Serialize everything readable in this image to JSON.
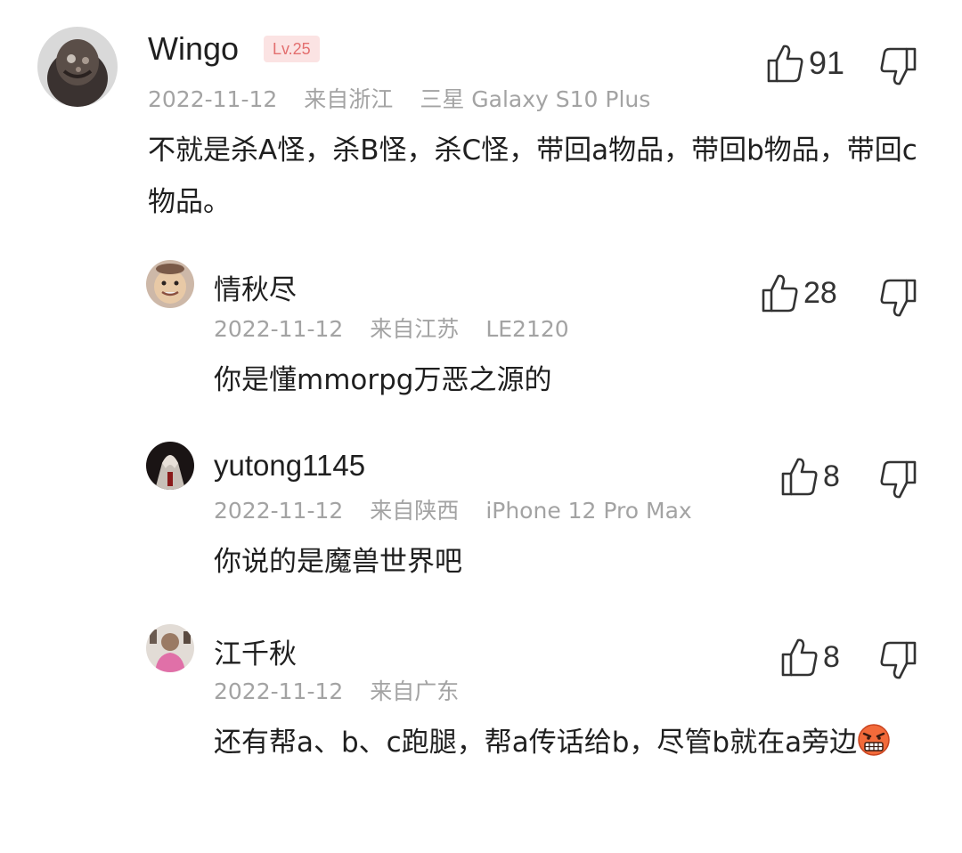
{
  "comments": [
    {
      "user": "Wingo",
      "level": "Lv.25",
      "date": "2022-11-12",
      "location": "来自浙江",
      "device": "三星 Galaxy S10 Plus",
      "text": "不就是杀A怪，杀B怪，杀C怪，带回a物品，带回b物品，带回c物品。",
      "likes": "91"
    },
    {
      "user": "情秋尽",
      "date": "2022-11-12",
      "location": "来自江苏",
      "device": "LE2120",
      "text": "你是懂mmorpg万恶之源的",
      "likes": "28"
    },
    {
      "user": "yutong1145",
      "date": "2022-11-12",
      "location": "来自陕西",
      "device": "iPhone 12 Pro Max",
      "text": "你说的是魔兽世界吧",
      "likes": "8"
    },
    {
      "user": "江千秋",
      "date": "2022-11-12",
      "location": "来自广东",
      "device": "",
      "text": "还有帮a、b、c跑腿，帮a传话给b，尽管b就在a旁边",
      "emoji": "angry-grimace-emoji",
      "likes": "8"
    }
  ],
  "icons": {
    "like": "thumbs-up-outline-icon",
    "dislike": "thumbs-down-outline-icon"
  },
  "colors": {
    "text": "#1f1f1f",
    "meta": "#a3a3a3",
    "badge_bg": "#fbe3e3",
    "badge_text": "#e36f6f"
  }
}
